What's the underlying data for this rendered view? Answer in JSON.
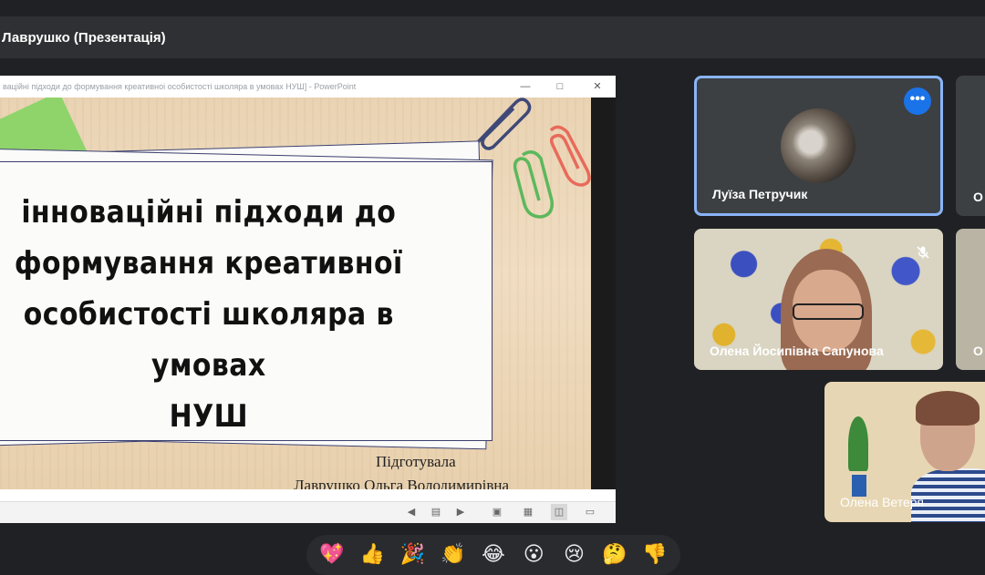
{
  "header": {
    "title": "Лаврушко (Презентація)"
  },
  "presentation": {
    "window_title": "вацiйнi пiдходи до формування креативноi особистостi школяра в умовах НУШ] - PowerPoint",
    "slide_title_lines": [
      "інноваційні підходи до",
      "формування креативної",
      "особистості школяра в умовах",
      "НУШ"
    ],
    "prepared_by": "Підготувала",
    "author": "Лаврушко Ольга Володимирівна"
  },
  "participants": [
    {
      "name": "Луїза Петручик"
    },
    {
      "name": "Олена Йосипівна Сапунова"
    },
    {
      "name": "Олена Ветеря"
    },
    {
      "name": "О"
    },
    {
      "name": "О"
    }
  ],
  "reactions": [
    "💖",
    "👍",
    "🎉",
    "👏",
    "😂",
    "😮",
    "😢",
    "🤔",
    "👎"
  ],
  "colors": {
    "accent": "#8ab4f8",
    "menu_button": "#1a73e8",
    "background": "#202124"
  }
}
